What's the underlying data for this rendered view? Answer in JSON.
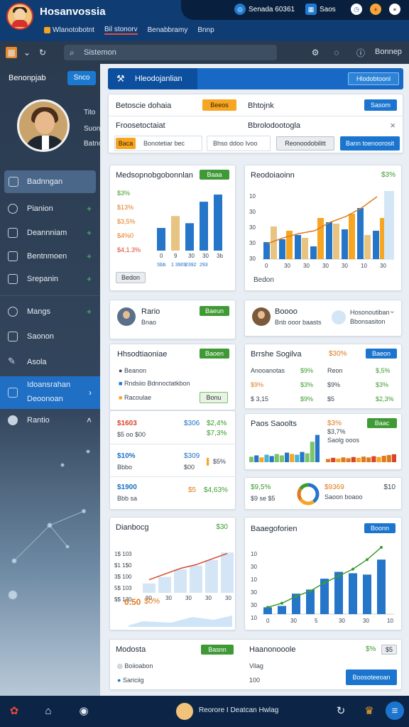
{
  "app": {
    "title": "Hosanvossia"
  },
  "menu": [
    {
      "label": "Wlanotobotnt"
    },
    {
      "label": "Bil stonorv"
    },
    {
      "label": "Benabbramy"
    },
    {
      "label": "Bnnp"
    }
  ],
  "status": {
    "item1": "Senada 60361",
    "item2": "Saos",
    "item1_icon": "circle-icon",
    "item2_icon": "grid-icon"
  },
  "colors": {
    "accent": "#1769c5",
    "green": "#3f9a36",
    "orange": "#f6a623",
    "topbar": "#0f3c73",
    "sidebar": "#2a3b50"
  },
  "search": {
    "placeholder": "Sistemon"
  },
  "toolbar": {
    "right_label": "Bonnep"
  },
  "sidebar": {
    "title": "Benonpjab",
    "button": "Snco",
    "profile_lines": [
      "Tito",
      "Suon",
      "Batno"
    ],
    "items": [
      {
        "label": "Badnngan",
        "icon": "doc-icon"
      },
      {
        "label": "Pianion",
        "icon": "clock-icon"
      },
      {
        "label": "Deannniam",
        "icon": "chart-icon"
      },
      {
        "label": "Bentnmoen",
        "icon": "mail-icon"
      },
      {
        "label": "Srepanin",
        "icon": "list-icon"
      },
      {
        "label": "Mangs",
        "icon": "globe-icon"
      },
      {
        "label": "Saonon",
        "icon": "edit-icon"
      },
      {
        "label": "Asola",
        "icon": "pen-icon"
      },
      {
        "label": "Idoansrahan",
        "label2": "Deoonoan",
        "icon": "table-icon"
      },
      {
        "label": "Rantio",
        "icon": "cloud-icon"
      }
    ]
  },
  "header": {
    "title": "Hleodojanlian",
    "button": "Hlodobtoonl"
  },
  "filter": {
    "label": "Betoscie dohaia",
    "tag": "Beeos",
    "label2": "Bhtojnk",
    "button": "Sasom",
    "row2_left": "Froosetoctaiat",
    "row2_right": "Bbrolodootogla",
    "row3_tag": "Baca",
    "row3_text": "Bonotetiar bec",
    "row3_mid": "Bhso ddoo Ivoo",
    "row3_btn1": "Reonoodobilitt",
    "row3_btn2": "Bann toenoorosit"
  },
  "card1": {
    "title": "Medsopnobgobonnlan",
    "button": "Baaa",
    "button2": "Bedon"
  },
  "card2": {
    "title": "Reodoiaoinn",
    "value": "$3%",
    "footer": "Bedon"
  },
  "card3": {
    "name": "Rario",
    "sub": "Bnao",
    "button": "Baeun"
  },
  "card4": {
    "name": "Boooo",
    "sub": "Bnb ooor baasts",
    "right": "Hosonoutiban",
    "right2": "Bbonsasiton"
  },
  "card5": {
    "title": "Hhsodtiaoniae",
    "button": "Baoen",
    "items": [
      "Beanon",
      "Rndsiio Bdnnoctatkbon",
      "Racoulae"
    ],
    "item_btn": "Bonu"
  },
  "card6": {
    "title": "Brrshe Sogilva",
    "value": "$30%",
    "button": "Baeon",
    "rows": [
      {
        "a": "Anooanotas",
        "b": "$9%",
        "c": "Reon",
        "d": "$,5%"
      },
      {
        "a": "$9%",
        "b": "$3%",
        "c": "$9%",
        "d": "$3%"
      },
      {
        "a": "$ 3,15",
        "b": "$9%",
        "c": "$5",
        "d": "$2,3%"
      }
    ]
  },
  "kpis": [
    {
      "a": "$1603",
      "sub": "$5 oo $00",
      "b": "$306",
      "c": "$2,4%",
      "d": "$7,3%"
    },
    {
      "a": "$10%",
      "sub": "Bbbo",
      "b": "$309",
      "sub2": "$00",
      "c": "$5%"
    },
    {
      "a": "$1900",
      "sub": "Bbb sa",
      "b": "$5",
      "c": "$4,63%"
    }
  ],
  "card7": {
    "title": "Paos Saoolts",
    "value": "$3%",
    "sub": "$3,7%",
    "sub2": "Saolg ooos",
    "button": "Baac"
  },
  "card8": {
    "a": "$9,5%",
    "sub": "$9 se $5",
    "b": "$9369",
    "sub2": "Saoon boaoo",
    "c": "$10"
  },
  "card9": {
    "title": "Dianbocg",
    "value": "$30",
    "big": "0.50",
    "big2": "$0%"
  },
  "card10": {
    "title": "Baaegoforien",
    "button": "Boonn"
  },
  "bottom_card": {
    "title": "Modosta",
    "button": "Basnn",
    "mid": "Haanonooole",
    "value": "$%",
    "tag": "$5",
    "items": [
      "Boiioabon",
      "Sariciig"
    ],
    "mid2": "Vilag",
    "mid3": "100",
    "cta": "Boosoteeoan"
  },
  "taskbar": {
    "center": "Reorore I Deatcan Hwlag"
  },
  "chart_data": [
    {
      "type": "bar",
      "title": "Medsopnobgobonnlan",
      "y_tick_labels": [
        "$3%",
        "$13%",
        "$3,5%",
        "$4%0",
        "$4,1.3%"
      ],
      "x_tick_labels": [
        "0",
        "9",
        "30",
        "30",
        "3b"
      ],
      "x_tick_labels2": [
        "Sbb",
        "1 3909",
        "2392",
        "293"
      ],
      "values": [
        38,
        58,
        46,
        82,
        94
      ]
    },
    {
      "type": "bar",
      "title": "Reodoiaoinn",
      "y_tick_labels": [
        "10",
        "30",
        "30",
        "30",
        "30"
      ],
      "x_tick_labels": [
        "0",
        "30",
        "30",
        "30",
        "30",
        "10",
        "30"
      ],
      "series": [
        {
          "values": [
            24,
            28,
            34,
            18,
            52,
            42,
            72,
            40
          ]
        },
        {
          "values": [
            46,
            40,
            30,
            58,
            50,
            64,
            34,
            58
          ]
        }
      ],
      "line": [
        22,
        30,
        36,
        40,
        52,
        60,
        72,
        88
      ]
    },
    {
      "type": "area",
      "title": "Dianbocg",
      "y_tick_labels": [
        "1$ 103",
        "$1 1$0",
        "3$ 100",
        "5$ 103",
        "$$ 130"
      ],
      "x_tick_labels": [
        "90",
        "30",
        "30",
        "30",
        "30"
      ],
      "values": [
        20,
        34,
        50,
        58,
        70,
        86
      ],
      "line": [
        28,
        40,
        52,
        60,
        72,
        84
      ]
    },
    {
      "type": "bar",
      "title": "Baaegoforien",
      "y_tick_labels": [
        "10",
        "30",
        "10",
        "30",
        "30",
        "10"
      ],
      "x_tick_labels": [
        "0",
        "30",
        "5",
        "30",
        "30",
        "10"
      ],
      "values": [
        10,
        12,
        30,
        36,
        52,
        62,
        60,
        58,
        80
      ],
      "line": [
        10,
        16,
        26,
        34,
        46,
        56,
        66,
        80,
        98
      ]
    },
    {
      "type": "bar",
      "title": "Paos Saoolts",
      "values": [
        16,
        20,
        14,
        22,
        18,
        24,
        20,
        28,
        24,
        22,
        30,
        26,
        60,
        80
      ]
    },
    {
      "type": "bar",
      "title": "Paos Saoolts",
      "values": [
        16,
        22,
        18,
        24,
        20,
        26,
        22,
        28,
        24,
        30,
        26,
        32,
        36,
        40
      ]
    },
    {
      "type": "pie",
      "values": [
        40,
        25,
        20,
        15
      ]
    }
  ]
}
